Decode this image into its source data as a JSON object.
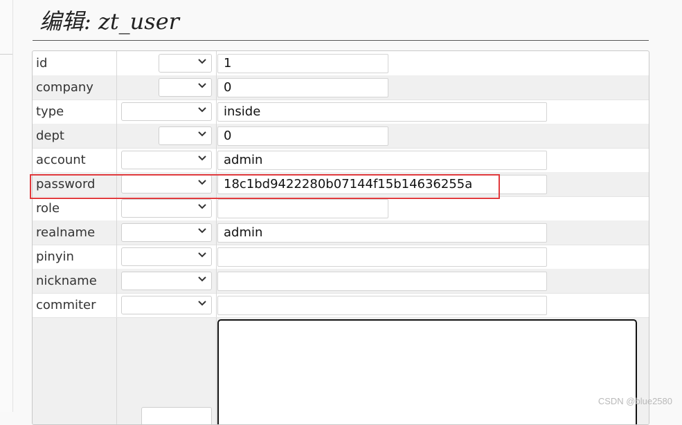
{
  "page_title": "编辑: zt_user",
  "fields": [
    {
      "name": "id",
      "value": "1"
    },
    {
      "name": "company",
      "value": "0"
    },
    {
      "name": "type",
      "value": "inside"
    },
    {
      "name": "dept",
      "value": "0"
    },
    {
      "name": "account",
      "value": "admin"
    },
    {
      "name": "password",
      "value": "18c1bd9422280b07144f15b14636255a"
    },
    {
      "name": "role",
      "value": ""
    },
    {
      "name": "realname",
      "value": "admin"
    },
    {
      "name": "pinyin",
      "value": ""
    },
    {
      "name": "nickname",
      "value": ""
    },
    {
      "name": "commiter",
      "value": ""
    }
  ],
  "highlight_color": "#e0393c",
  "watermark": "CSDN @blue2580"
}
